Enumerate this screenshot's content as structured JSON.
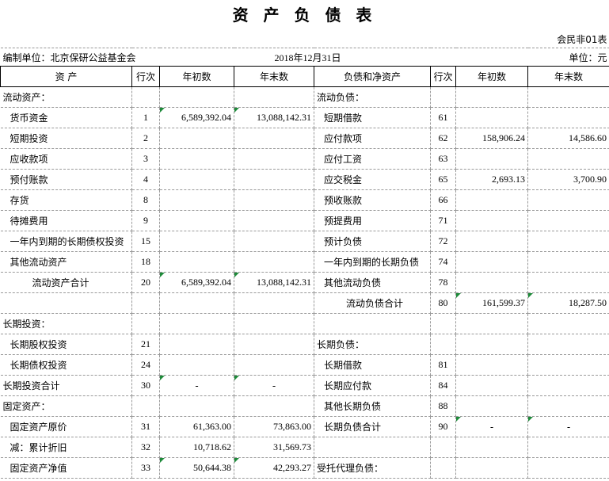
{
  "title": "资 产 负 债 表",
  "form_code": "会民非01表",
  "org_label": "编制单位：北京保研公益基金会",
  "date": "2018年12月31日",
  "unit": "单位：元",
  "headers": {
    "asset": "资        产",
    "line": "行次",
    "begin": "年初数",
    "end": "年末数",
    "liab": "负债和净资产",
    "line2": "行次",
    "begin2": "年初数",
    "end2": "年末数"
  },
  "rows": [
    [
      "流动资产：",
      "",
      "",
      "",
      "流动负债：",
      "",
      "",
      ""
    ],
    [
      "货币资金",
      "1",
      "6,589,392.04",
      "13,088,142.31",
      "短期借款",
      "61",
      "",
      ""
    ],
    [
      "短期投资",
      "2",
      "",
      "",
      "应付款项",
      "62",
      "158,906.24",
      "14,586.60"
    ],
    [
      "应收款项",
      "3",
      "",
      "",
      "应付工资",
      "63",
      "",
      ""
    ],
    [
      "预付账款",
      "4",
      "",
      "",
      "应交税金",
      "65",
      "2,693.13",
      "3,700.90"
    ],
    [
      "存货",
      "8",
      "",
      "",
      "预收账款",
      "66",
      "",
      ""
    ],
    [
      "待摊费用",
      "9",
      "",
      "",
      "预提费用",
      "71",
      "",
      ""
    ],
    [
      "一年内到期的长期债权投资",
      "15",
      "",
      "",
      "预计负债",
      "72",
      "",
      ""
    ],
    [
      "其他流动资产",
      "18",
      "",
      "",
      "一年内到期的长期负债",
      "74",
      "",
      ""
    ],
    [
      "流动资产合计",
      "20",
      "6,589,392.04",
      "13,088,142.31",
      "其他流动负债",
      "78",
      "",
      ""
    ],
    [
      "",
      "",
      "",
      "",
      "流动负债合计",
      "80",
      "161,599.37",
      "18,287.50"
    ],
    [
      "长期投资：",
      "",
      "",
      "",
      "",
      "",
      "",
      ""
    ],
    [
      "长期股权投资",
      "21",
      "",
      "",
      "长期负债：",
      "",
      "",
      ""
    ],
    [
      "长期债权投资",
      "24",
      "",
      "",
      "长期借款",
      "81",
      "",
      ""
    ],
    [
      "长期投资合计",
      "30",
      "-",
      "-",
      "长期应付款",
      "84",
      "",
      ""
    ],
    [
      "固定资产：",
      "",
      "",
      "",
      "其他长期负债",
      "88",
      "",
      ""
    ],
    [
      "固定资产原价",
      "31",
      "61,363.00",
      "73,863.00",
      "长期负债合计",
      "90",
      "-",
      "-"
    ],
    [
      "减：累计折旧",
      "32",
      "10,718.62",
      "31,569.73",
      "",
      "",
      "",
      ""
    ],
    [
      "固定资产净值",
      "33",
      "50,644.38",
      "42,293.27",
      "受托代理负债：",
      "",
      "",
      ""
    ]
  ]
}
